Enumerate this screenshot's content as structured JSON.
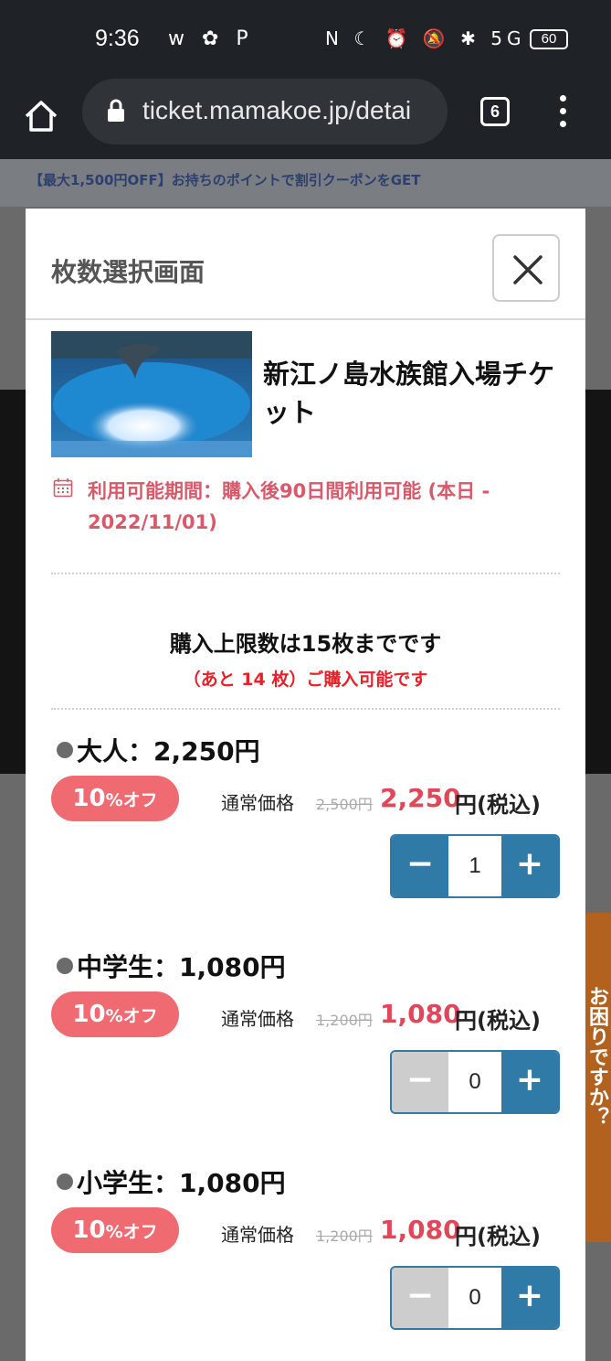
{
  "status_bar": {
    "time": "9:36",
    "left_icons": "w ✿ P",
    "right_icons": "N ☾ ⏰ 🔕 ✱ 5G",
    "battery": "60"
  },
  "browser": {
    "url": "ticket.mamakoe.jp/detai",
    "tab_count": "6"
  },
  "background_page": {
    "banner": "【最大1,500円OFF】お持ちのポイントで割引クーポンをGET",
    "side_tab": "お困りですか？"
  },
  "modal": {
    "title": "枚数選択画面",
    "product": {
      "title": "新江ノ島水族館入場チケット",
      "validity": "利用可能期間：購入後90日間利用可能 (本日 - 2022/11/01)"
    },
    "limit_text": "購入上限数は15枚までです",
    "remaining_text": "（あと 14 枚）ご購入可能です",
    "normal_price_label": "通常価格",
    "tax_label": "円(税込)",
    "discount_number": "10",
    "discount_suffix": "%オフ",
    "tickets": [
      {
        "name": "大人：2,250円",
        "original": "2,500円",
        "price": "2,250",
        "quantity": "1",
        "minus_enabled": true
      },
      {
        "name": "中学生：1,080円",
        "original": "1,200円",
        "price": "1,080",
        "quantity": "0",
        "minus_enabled": false
      },
      {
        "name": "小学生：1,080円",
        "original": "1,200円",
        "price": "1,080",
        "quantity": "0",
        "minus_enabled": false
      }
    ]
  },
  "colors": {
    "accent": "#2f7aa7",
    "price": "#e0485a",
    "discount_badge": "#f06a72",
    "notice_red": "#e8202a"
  }
}
